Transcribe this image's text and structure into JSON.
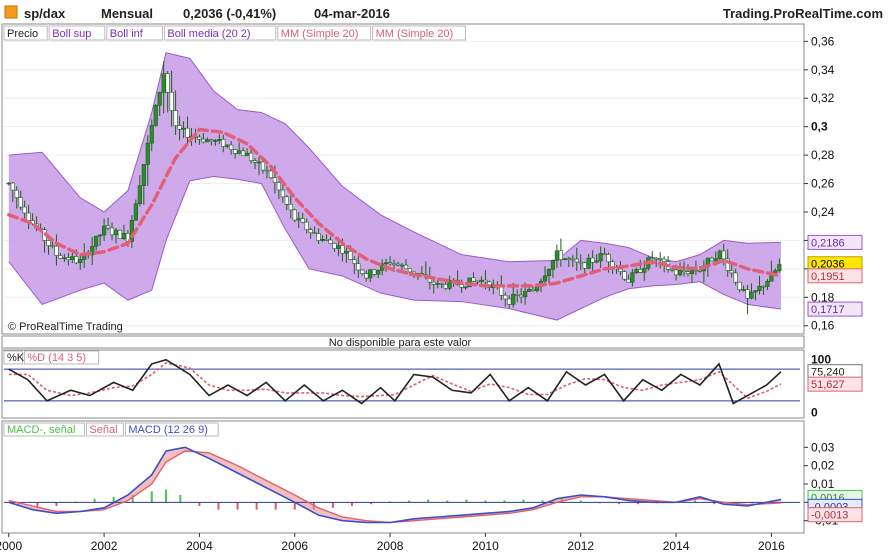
{
  "header": {
    "symbol": "sp/dax",
    "period": "Mensual",
    "last": "0,2036 (-0,41%)",
    "date": "04-mar-2016",
    "site": "Trading.ProRealTime.com"
  },
  "legend_price": [
    "Precio",
    "Boll sup",
    "Boll inf",
    "Boll media (20 2)",
    "MM (Simple 20)",
    "MM (Simple 20)"
  ],
  "watermark": "© ProRealTime Trading",
  "not_available": "No disponible para este valor",
  "legend_stoch": [
    "%K",
    "%D (14 3 5)"
  ],
  "legend_macd": [
    "MACD-, señal",
    "Señal",
    "MACD (12 26 9)"
  ],
  "colors": {
    "candle": "#2e8b2e",
    "band_fill": "#c79be8",
    "band_edge": "#9b59c9",
    "ma": "#e0607a",
    "k_line": "#222222",
    "d_line": "#e06070",
    "macd": "#3b4fc9",
    "signal": "#e06070",
    "hist_pos": "#4cc04c",
    "hist_neg": "#e05a5a",
    "level_line": "#2a3a9a"
  },
  "badges": {
    "boll_sup": "0,2186",
    "last": "0,2036",
    "ma": "0,1951",
    "boll_inf": "0,1717",
    "stoch_k": "75,240",
    "stoch_d": "51,627",
    "macd_a": "0,0016",
    "macd_b": "-0,0003",
    "macd_c": "-0,0013"
  },
  "chart_data": [
    {
      "type": "candlestick",
      "panel": "price",
      "x_ticks": [
        "2000",
        "2002",
        "2004",
        "2006",
        "2008",
        "2010",
        "2012",
        "2014",
        "2016"
      ],
      "x_range": [
        1999.9,
        2016.6
      ],
      "y_ticks": [
        "0,16",
        "0,18",
        "0,2",
        "0,22",
        "0,24",
        "0,26",
        "0,28",
        "0,3",
        "0,32",
        "0,34",
        "0,36"
      ],
      "y_range": [
        0.157,
        0.368
      ],
      "price_series": {
        "x": [
          2000,
          2000.5,
          2001,
          2001.5,
          2002,
          2002.5,
          2003,
          2003.25,
          2003.5,
          2004,
          2004.5,
          2005,
          2005.5,
          2006,
          2006.5,
          2007,
          2007.5,
          2008,
          2008.5,
          2009,
          2009.5,
          2010,
          2010.5,
          2011,
          2011.5,
          2012,
          2012.5,
          2013,
          2013.5,
          2014,
          2014.5,
          2014.9,
          2015.2,
          2015.5,
          2016,
          2016.2
        ],
        "y": [
          0.26,
          0.232,
          0.21,
          0.205,
          0.228,
          0.222,
          0.3,
          0.338,
          0.298,
          0.292,
          0.288,
          0.28,
          0.265,
          0.235,
          0.222,
          0.214,
          0.195,
          0.205,
          0.198,
          0.188,
          0.19,
          0.192,
          0.178,
          0.185,
          0.21,
          0.202,
          0.21,
          0.192,
          0.208,
          0.197,
          0.2,
          0.212,
          0.195,
          0.178,
          0.195,
          0.2036
        ]
      },
      "boll_sup": {
        "x": [
          2000,
          2000.7,
          2001.5,
          2002,
          2002.5,
          2003,
          2003.3,
          2003.8,
          2004.3,
          2004.8,
          2005.3,
          2005.8,
          2006.3,
          2007,
          2007.8,
          2008.5,
          2009.5,
          2010.5,
          2011.5,
          2012,
          2012.5,
          2013,
          2013.5,
          2014,
          2014.5,
          2015,
          2015.5,
          2016.2
        ],
        "y": [
          0.28,
          0.282,
          0.25,
          0.24,
          0.255,
          0.31,
          0.352,
          0.348,
          0.325,
          0.312,
          0.31,
          0.302,
          0.285,
          0.258,
          0.238,
          0.226,
          0.21,
          0.205,
          0.206,
          0.22,
          0.218,
          0.215,
          0.208,
          0.205,
          0.21,
          0.22,
          0.218,
          0.2186
        ]
      },
      "boll_inf": {
        "x": [
          2000,
          2000.7,
          2001.5,
          2002,
          2002.5,
          2003,
          2003.3,
          2003.8,
          2004.3,
          2004.8,
          2005.3,
          2005.8,
          2006.3,
          2007,
          2007.8,
          2008.5,
          2009.5,
          2010.5,
          2011,
          2011.5,
          2012,
          2012.5,
          2013,
          2013.5,
          2014,
          2014.5,
          2015,
          2015.5,
          2016.2
        ],
        "y": [
          0.205,
          0.175,
          0.185,
          0.19,
          0.178,
          0.185,
          0.22,
          0.262,
          0.265,
          0.263,
          0.26,
          0.228,
          0.2,
          0.195,
          0.183,
          0.178,
          0.177,
          0.172,
          0.168,
          0.164,
          0.172,
          0.18,
          0.186,
          0.188,
          0.189,
          0.191,
          0.182,
          0.175,
          0.1717
        ]
      },
      "ma": {
        "x": [
          2000,
          2000.5,
          2001,
          2001.5,
          2002,
          2002.5,
          2003,
          2003.5,
          2004,
          2004.5,
          2005,
          2005.5,
          2006,
          2006.5,
          2007,
          2007.5,
          2008,
          2008.5,
          2009,
          2009.5,
          2010,
          2010.5,
          2011,
          2011.5,
          2012,
          2012.5,
          2013,
          2013.5,
          2014,
          2014.5,
          2015,
          2015.5,
          2016.2
        ],
        "y": [
          0.238,
          0.232,
          0.218,
          0.21,
          0.212,
          0.218,
          0.245,
          0.278,
          0.298,
          0.296,
          0.288,
          0.272,
          0.25,
          0.232,
          0.218,
          0.207,
          0.2,
          0.196,
          0.193,
          0.19,
          0.188,
          0.188,
          0.188,
          0.19,
          0.195,
          0.2,
          0.202,
          0.205,
          0.201,
          0.2,
          0.206,
          0.2,
          0.1951
        ]
      }
    },
    {
      "type": "line",
      "panel": "stochastic",
      "y_ticks": [
        "100",
        "0"
      ],
      "y_range": [
        -5,
        105
      ],
      "levels": [
        80,
        20
      ],
      "k": {
        "x": [
          2000,
          2000.4,
          2000.8,
          2001.3,
          2001.7,
          2002.2,
          2002.6,
          2003,
          2003.3,
          2003.8,
          2004.2,
          2004.6,
          2005,
          2005.4,
          2005.8,
          2006.2,
          2006.6,
          2007,
          2007.4,
          2007.8,
          2008.1,
          2008.5,
          2008.9,
          2009.3,
          2009.7,
          2010.1,
          2010.5,
          2010.9,
          2011.3,
          2011.7,
          2012.1,
          2012.5,
          2012.9,
          2013.3,
          2013.7,
          2014.1,
          2014.5,
          2014.9,
          2015.2,
          2015.5,
          2015.9,
          2016.2
        ],
        "y": [
          80,
          60,
          20,
          40,
          30,
          55,
          40,
          90,
          98,
          70,
          30,
          50,
          30,
          55,
          20,
          50,
          20,
          40,
          15,
          45,
          20,
          70,
          65,
          40,
          35,
          70,
          20,
          45,
          20,
          75,
          50,
          70,
          20,
          60,
          40,
          70,
          50,
          90,
          15,
          30,
          50,
          75
        ]
      },
      "d": {
        "x": [
          2000,
          2000.4,
          2000.8,
          2001.3,
          2001.7,
          2002.2,
          2002.6,
          2003,
          2003.3,
          2003.8,
          2004.2,
          2004.6,
          2005,
          2005.4,
          2005.8,
          2006.2,
          2006.6,
          2007,
          2007.4,
          2007.8,
          2008.1,
          2008.5,
          2008.9,
          2009.3,
          2009.7,
          2010.1,
          2010.5,
          2010.9,
          2011.3,
          2011.7,
          2012.1,
          2012.5,
          2012.9,
          2013.3,
          2013.7,
          2014.1,
          2014.5,
          2014.9,
          2015.2,
          2015.5,
          2015.9,
          2016.2
        ],
        "y": [
          70,
          70,
          40,
          30,
          35,
          45,
          48,
          70,
          92,
          82,
          50,
          40,
          40,
          42,
          35,
          35,
          35,
          30,
          28,
          30,
          32,
          50,
          68,
          52,
          38,
          52,
          45,
          32,
          32,
          50,
          62,
          60,
          45,
          40,
          50,
          55,
          60,
          75,
          50,
          25,
          38,
          52
        ]
      }
    },
    {
      "type": "line",
      "panel": "macd",
      "y_ticks": [
        "0,03",
        "0,02",
        "0,01",
        "0",
        "-0,01"
      ],
      "y_range": [
        -0.014,
        0.034
      ],
      "macd": {
        "x": [
          2000,
          2000.5,
          2001,
          2001.5,
          2002,
          2002.5,
          2003,
          2003.3,
          2003.7,
          2004.2,
          2004.8,
          2005.4,
          2006,
          2006.5,
          2007,
          2007.5,
          2008,
          2008.5,
          2009,
          2009.5,
          2010,
          2010.5,
          2011,
          2011.5,
          2012,
          2012.5,
          2013,
          2013.5,
          2014,
          2014.5,
          2015,
          2015.5,
          2016.2
        ],
        "y": [
          0.0,
          -0.004,
          -0.006,
          -0.005,
          -0.003,
          0.004,
          0.015,
          0.028,
          0.03,
          0.024,
          0.016,
          0.008,
          0.0,
          -0.007,
          -0.01,
          -0.011,
          -0.011,
          -0.009,
          -0.008,
          -0.007,
          -0.006,
          -0.005,
          -0.003,
          0.002,
          0.004,
          0.003,
          0.001,
          0.0,
          0.0,
          0.003,
          -0.001,
          -0.002,
          0.0016
        ]
      },
      "signal": {
        "x": [
          2000,
          2000.5,
          2001,
          2001.5,
          2002,
          2002.5,
          2003,
          2003.3,
          2003.7,
          2004.2,
          2004.8,
          2005.4,
          2006,
          2006.5,
          2007,
          2007.5,
          2008,
          2008.5,
          2009,
          2009.5,
          2010,
          2010.5,
          2011,
          2011.5,
          2012,
          2012.5,
          2013,
          2013.5,
          2014,
          2014.5,
          2015,
          2015.5,
          2016.2
        ],
        "y": [
          0.001,
          -0.002,
          -0.005,
          -0.005,
          -0.004,
          0.001,
          0.01,
          0.022,
          0.028,
          0.027,
          0.02,
          0.012,
          0.004,
          -0.003,
          -0.008,
          -0.01,
          -0.011,
          -0.01,
          -0.009,
          -0.008,
          -0.007,
          -0.006,
          -0.004,
          0.0,
          0.003,
          0.003,
          0.002,
          0.001,
          0.0,
          0.002,
          0.0,
          -0.0013,
          -0.0003
        ]
      },
      "histogram": {
        "x": [
          2000.2,
          2000.6,
          2001,
          2001.4,
          2001.8,
          2002.2,
          2002.6,
          2003,
          2003.3,
          2003.6,
          2004,
          2004.4,
          2004.8,
          2005.2,
          2005.6,
          2006,
          2006.4,
          2006.8,
          2007.2,
          2007.6,
          2008,
          2008.4,
          2008.8,
          2009.2,
          2009.6,
          2010,
          2010.4,
          2010.8,
          2011.2,
          2011.6,
          2012,
          2012.4,
          2012.8,
          2013.2,
          2013.6,
          2014,
          2014.4,
          2014.8,
          2015.2,
          2015.6,
          2016
        ],
        "y": [
          -0.002,
          -0.003,
          -0.002,
          0.0005,
          0.002,
          0.003,
          0.004,
          0.006,
          0.007,
          0.004,
          -0.002,
          -0.004,
          -0.004,
          -0.004,
          -0.004,
          -0.004,
          -0.004,
          -0.003,
          -0.002,
          -0.001,
          0.0005,
          0.001,
          0.0015,
          0.001,
          0.0015,
          0.001,
          0.001,
          0.0015,
          0.001,
          0.002,
          0.001,
          0.0,
          -0.001,
          -0.001,
          0.0,
          0.0005,
          0.001,
          -0.001,
          -0.001,
          -0.0005,
          0.0005
        ]
      }
    }
  ]
}
